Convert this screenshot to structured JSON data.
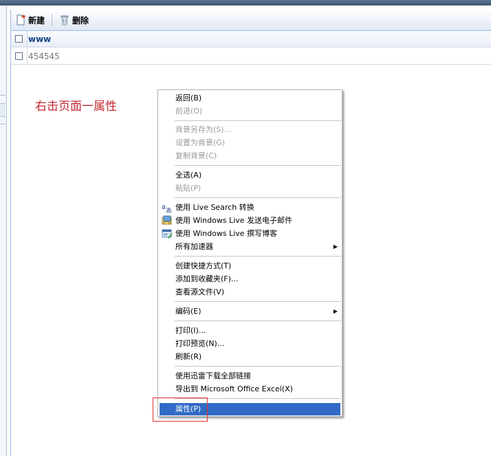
{
  "toolbar": {
    "new_label": "新建",
    "delete_label": "删除"
  },
  "grid": {
    "header": "www",
    "rows": [
      "454545"
    ]
  },
  "annotation": "右击页面一属性",
  "context_menu": {
    "items": [
      {
        "label": "返回(B)",
        "disabled": false
      },
      {
        "label": "前进(O)",
        "disabled": true
      },
      {
        "label": "背景另存为(S)...",
        "disabled": true
      },
      {
        "label": "设置为背景(G)",
        "disabled": true
      },
      {
        "label": "复制背景(C)",
        "disabled": true
      },
      {
        "label": "全选(A)",
        "disabled": false
      },
      {
        "label": "粘贴(P)",
        "disabled": true
      },
      {
        "label": "使用 Live Search 转换",
        "disabled": false,
        "icon": "translate-icon"
      },
      {
        "label": "使用 Windows Live 发送电子邮件",
        "disabled": false,
        "icon": "email-icon"
      },
      {
        "label": "使用 Windows Live 撰写博客",
        "disabled": false,
        "icon": "blog-icon"
      },
      {
        "label": "所有加速器",
        "disabled": false,
        "submenu": true
      },
      {
        "label": "创建快捷方式(T)",
        "disabled": false
      },
      {
        "label": "添加到收藏夹(F)...",
        "disabled": false
      },
      {
        "label": "查看源文件(V)",
        "disabled": false
      },
      {
        "label": "编码(E)",
        "disabled": false,
        "submenu": true
      },
      {
        "label": "打印(I)...",
        "disabled": false
      },
      {
        "label": "打印预览(N)...",
        "disabled": false
      },
      {
        "label": "刷新(R)",
        "disabled": false
      },
      {
        "label": "使用迅雷下载全部链接",
        "disabled": false
      },
      {
        "label": "导出到 Microsoft Office Excel(X)",
        "disabled": false
      },
      {
        "label": "属性(P)",
        "disabled": false,
        "selected": true
      }
    ]
  },
  "colors": {
    "selection": "#316ac5",
    "annotation": "#c0282f",
    "grid_header_text": "#15428b"
  }
}
